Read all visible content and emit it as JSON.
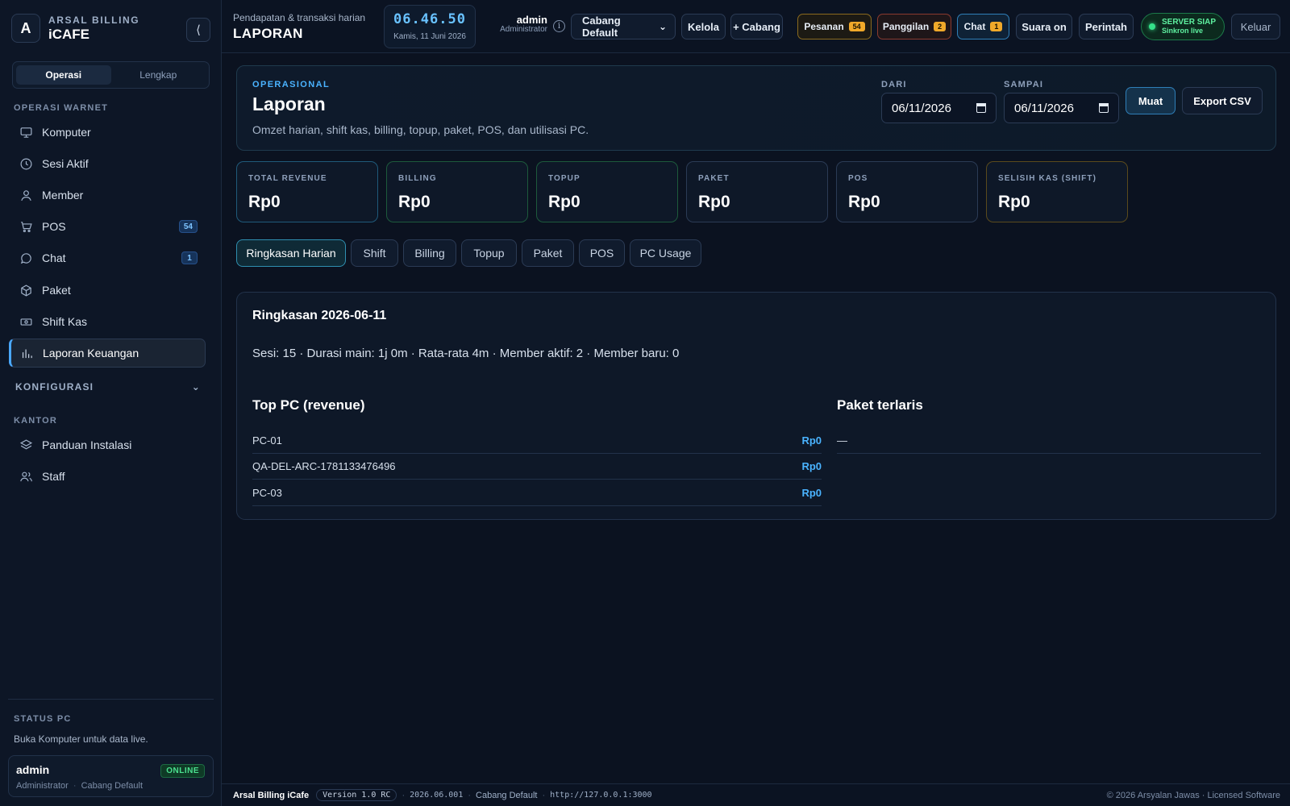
{
  "brand": {
    "logo_letter": "A",
    "sub": "ARSAL BILLING",
    "main": "iCAFE",
    "collapse_glyph": "⟨"
  },
  "sidebar": {
    "mode_tabs": [
      "Operasi",
      "Lengkap"
    ],
    "section_operasi": "OPERASI WARNET",
    "items": [
      {
        "label": "Komputer",
        "icon": "monitor-icon"
      },
      {
        "label": "Sesi Aktif",
        "icon": "clock-icon"
      },
      {
        "label": "Member",
        "icon": "user-icon"
      },
      {
        "label": "POS",
        "icon": "cart-icon",
        "badge": "54"
      },
      {
        "label": "Chat",
        "icon": "chat-icon",
        "badge": "1"
      },
      {
        "label": "Paket",
        "icon": "box-icon"
      },
      {
        "label": "Shift Kas",
        "icon": "cash-icon"
      },
      {
        "label": "Laporan Keuangan",
        "icon": "bar-chart-icon",
        "active": true
      }
    ],
    "section_konfig": "KONFIGURASI",
    "konfig_chevron": "⌄",
    "section_kantor": "KANTOR",
    "kantor_items": [
      {
        "label": "Panduan Instalasi",
        "icon": "layers-icon"
      },
      {
        "label": "Staff",
        "icon": "users-icon"
      }
    ],
    "status_label": "STATUS PC",
    "status_text": "Buka Komputer untuk data live.",
    "user": {
      "name": "admin",
      "role": "Administrator",
      "branch": "Cabang Default",
      "status": "ONLINE"
    }
  },
  "topbar": {
    "subtitle": "Pendapatan & transaksi harian",
    "title": "LAPORAN",
    "clock_time": "06.46.50",
    "clock_date": "Kamis, 11 Juni 2026",
    "admin_name": "admin",
    "admin_role": "Administrator",
    "info_glyph": "i",
    "branch_select": "Cabang Default",
    "select_caret": "⌄",
    "kelola": "Kelola",
    "add_branch": "+ Cabang",
    "pesanan": {
      "label": "Pesanan",
      "count": "54"
    },
    "panggilan": {
      "label": "Panggilan",
      "count": "2"
    },
    "chat": {
      "label": "Chat",
      "count": "1"
    },
    "suara": "Suara on",
    "perintah": "Perintah",
    "server_status": "SERVER SIAP",
    "server_sub": "Sinkron live",
    "logout": "Keluar"
  },
  "hero": {
    "eyebrow": "OPERASIONAL",
    "title": "Laporan",
    "desc": "Omzet harian, shift kas, billing, topup, paket, POS, dan utilisasi PC.",
    "from_label": "DARI",
    "from_value": "06/11/2026",
    "to_label": "SAMPAI",
    "to_value": "06/11/2026",
    "load": "Muat",
    "export": "Export CSV"
  },
  "kpis": [
    {
      "label": "TOTAL REVENUE",
      "value": "Rp0",
      "accent": "#1f5a7a"
    },
    {
      "label": "BILLING",
      "value": "Rp0",
      "accent": "#1d5a3c"
    },
    {
      "label": "TOPUP",
      "value": "Rp0",
      "accent": "#1d5a3c"
    },
    {
      "label": "PAKET",
      "value": "Rp0",
      "accent": "#2b3b55"
    },
    {
      "label": "POS",
      "value": "Rp0",
      "accent": "#2b3b55"
    },
    {
      "label": "SELISIH KAS (SHIFT)",
      "value": "Rp0",
      "accent": "#5a4a1c"
    }
  ],
  "tabs": [
    "Ringkasan Harian",
    "Shift",
    "Billing",
    "Topup",
    "Paket",
    "POS",
    "PC Usage"
  ],
  "summary": {
    "title": "Ringkasan 2026-06-11",
    "stats": "Sesi: 15 · Durasi main: 1j 0m · Rata-rata 4m · Member aktif: 2 · Member baru: 0",
    "top_pc_title": "Top PC (revenue)",
    "top_pc": [
      {
        "name": "PC-01",
        "amount": "Rp0"
      },
      {
        "name": "QA-DEL-ARC-1781133476496",
        "amount": "Rp0"
      },
      {
        "name": "PC-03",
        "amount": "Rp0"
      }
    ],
    "packages_title": "Paket terlaris",
    "packages_empty": "—"
  },
  "footer": {
    "brand": "Arsal Billing iCafe",
    "version": "Version 1.0 RC",
    "sep": "·",
    "build": "2026.06.001",
    "branch": "Cabang Default",
    "url": "http://127.0.0.1:3000",
    "copyright": "© 2026 Arsyalan Jawas · Licensed Software"
  },
  "colors": {
    "accent": "#4ab3ff",
    "online": "#35e28a",
    "warn_badge": "#f0a92a"
  }
}
